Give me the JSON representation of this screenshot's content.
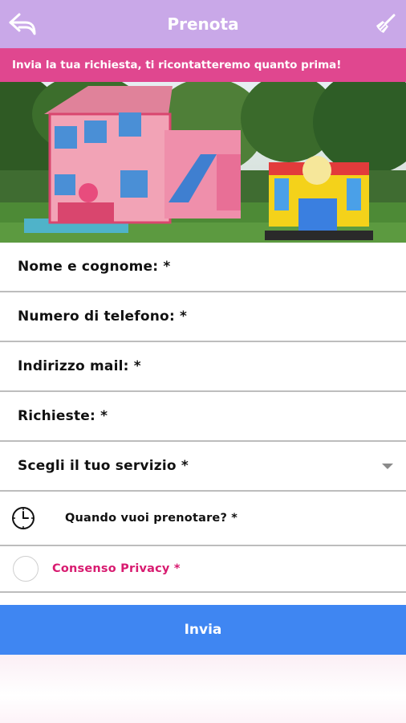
{
  "header": {
    "title": "Prenota",
    "back_icon": "back-arrow-icon",
    "clean_icon": "broom-icon",
    "bg_color": "#c9a8e8"
  },
  "banner": {
    "text": "Invia la tua richiesta, ti ricontatteremo quanto prima!",
    "bg_color": "#e0478f"
  },
  "hero": {
    "image": "inflatable-bouncy-castles-photo"
  },
  "form": {
    "fields": [
      {
        "label": "Nome e cognome: *"
      },
      {
        "label": "Numero di telefono: *"
      },
      {
        "label": "Indirizzo mail: *"
      },
      {
        "label": "Richieste: *"
      }
    ],
    "service_select": {
      "label": "Scegli il tuo servizio *",
      "icon": "dropdown-arrow-icon"
    },
    "date_picker": {
      "label": "Quando vuoi prenotare? *",
      "icon": "clock-icon"
    },
    "privacy": {
      "label": "Consenso Privacy *",
      "color": "#d81b70"
    }
  },
  "submit": {
    "label": "Invia",
    "bg_color": "#3f86f2"
  }
}
